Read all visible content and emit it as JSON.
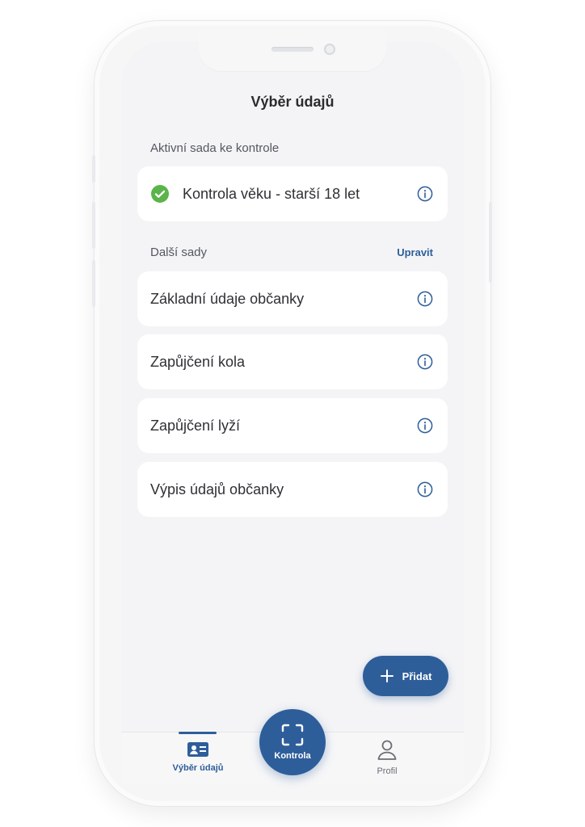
{
  "header": {
    "title": "Výběr údajů"
  },
  "active_section": {
    "label": "Aktivní sada ke kontrole",
    "item": {
      "label": "Kontrola věku - starší 18 let",
      "checked": true
    }
  },
  "other_section": {
    "label": "Další sady",
    "edit_label": "Upravit",
    "items": [
      {
        "label": "Základní údaje občanky"
      },
      {
        "label": "Zapůjčení kola"
      },
      {
        "label": "Zapůjčení lyží"
      },
      {
        "label": "Výpis údajů občanky"
      }
    ]
  },
  "add_button": {
    "label": "Přidat"
  },
  "tabbar": {
    "tabs": [
      {
        "label": "Výběr údajů",
        "icon": "id-card-icon",
        "active": true
      },
      {
        "label": "Kontrola",
        "icon": "scan-icon"
      },
      {
        "label": "Profil",
        "icon": "person-icon"
      }
    ]
  },
  "colors": {
    "accent": "#2e5e9a",
    "success": "#5bb44a",
    "card": "#ffffff",
    "screen_bg": "#f4f4f6"
  }
}
